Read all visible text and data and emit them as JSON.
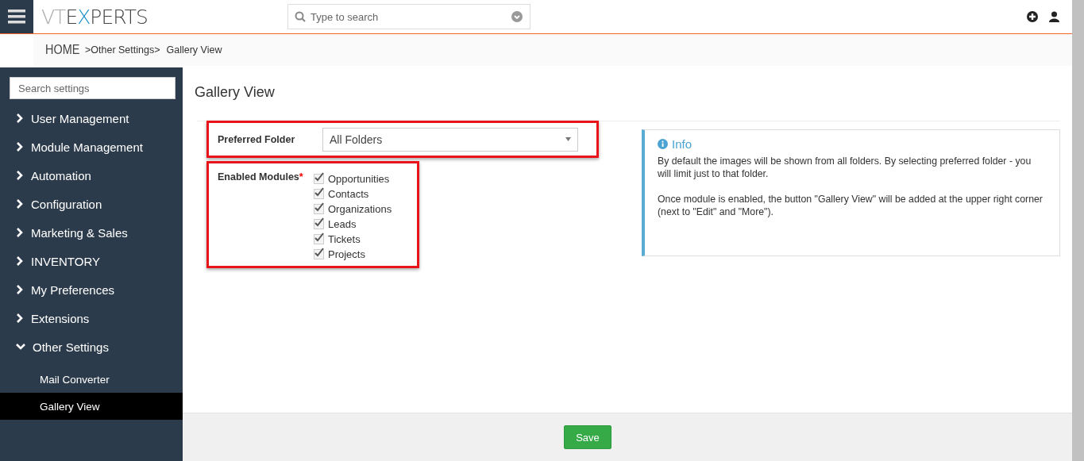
{
  "header": {
    "logo": "VTEXPERTS",
    "search": {
      "placeholder": "Type to search"
    }
  },
  "breadcrumb": [
    {
      "label": "HOME",
      "kind": "home"
    },
    {
      "label": ">Other Settings>",
      "kind": "link"
    },
    {
      "label": "Gallery View",
      "kind": "current"
    }
  ],
  "sidebar": {
    "search": {
      "placeholder": "Search settings"
    },
    "items": [
      {
        "label": "User Management",
        "expanded": false
      },
      {
        "label": "Module Management",
        "expanded": false
      },
      {
        "label": "Automation",
        "expanded": false
      },
      {
        "label": "Configuration",
        "expanded": false
      },
      {
        "label": "Marketing & Sales",
        "expanded": false
      },
      {
        "label": "INVENTORY",
        "expanded": false
      },
      {
        "label": "My Preferences",
        "expanded": false
      },
      {
        "label": "Extensions",
        "expanded": false
      },
      {
        "label": "Other Settings",
        "expanded": true,
        "children": [
          {
            "label": "Mail Converter",
            "selected": false
          },
          {
            "label": "Gallery View",
            "selected": true
          }
        ]
      }
    ]
  },
  "page": {
    "title": "Gallery View",
    "preferred_folder": {
      "label": "Preferred Folder",
      "value": "All Folders"
    },
    "enabled_modules": {
      "label": "Enabled Modules",
      "required_mark": "*",
      "options": [
        {
          "label": "Opportunities",
          "checked": true
        },
        {
          "label": "Contacts",
          "checked": true
        },
        {
          "label": "Organizations",
          "checked": true
        },
        {
          "label": "Leads",
          "checked": true
        },
        {
          "label": "Tickets",
          "checked": true
        },
        {
          "label": "Projects",
          "checked": true
        }
      ]
    },
    "info": {
      "title": "Info",
      "paragraphs": [
        "By default the images will be shown from all folders. By selecting preferred folder - you will limit just to that folder.",
        "Once module is enabled, the button \"Gallery View\" will be added at the upper right corner (next to \"Edit\" and \"More\")."
      ]
    }
  },
  "footer": {
    "buttons": [
      "Save"
    ]
  }
}
